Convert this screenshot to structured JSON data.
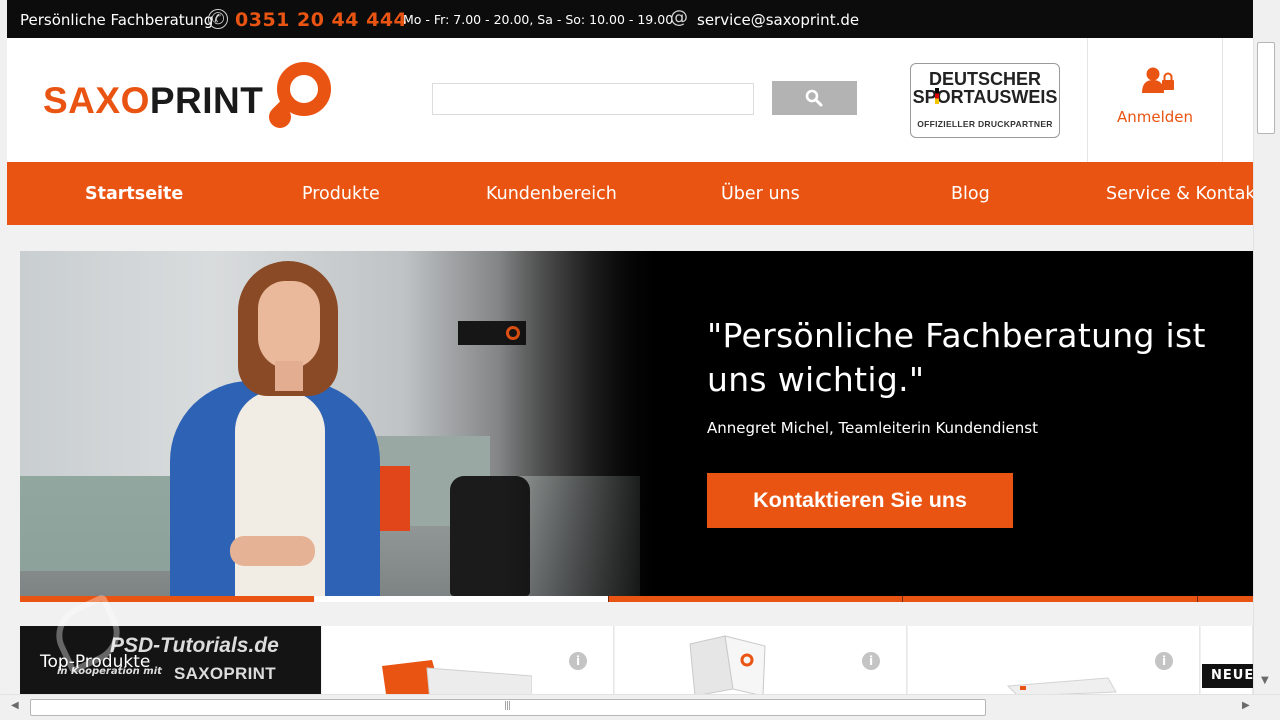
{
  "topbar": {
    "label": "Persönliche Fachberatung",
    "phone": "0351 20 44 444",
    "hours": "Mo - Fr: 7.00 - 20.00, Sa - So: 10.00 - 19.00",
    "email": "service@saxoprint.de"
  },
  "header": {
    "logo_text_orange": "SAXO",
    "logo_text_dark": "PRINT",
    "search": {
      "value": "",
      "placeholder": ""
    },
    "partner_badge": {
      "line1": "DEUTSCHER",
      "line2": "SPORTAUSWEIS",
      "line3": "OFFIZIELLER DRUCKPARTNER"
    },
    "login_label": "Anmelden"
  },
  "nav": {
    "items": [
      {
        "label": "Startseite",
        "active": true
      },
      {
        "label": "Produkte",
        "active": false
      },
      {
        "label": "Kundenbereich",
        "active": false
      },
      {
        "label": "Über uns",
        "active": false
      },
      {
        "label": "Blog",
        "active": false
      },
      {
        "label": "Service & Kontakt",
        "active": false
      }
    ]
  },
  "hero": {
    "quote": "\"Persönliche Fachberatung ist uns wichtig.\"",
    "author": "Annegret Michel, Teamleiterin Kundendienst",
    "cta_label": "Kontaktieren Sie uns",
    "slides_total": 5,
    "slide_current": 2
  },
  "products": {
    "section_label": "Top-Produkte",
    "info_icon_char": "i",
    "new_badge": "NEUE"
  },
  "watermark": {
    "line1": "PSD-Tutorials.de",
    "line2": "in Kooperation mit",
    "line3": "SAXOPRINT"
  },
  "colors": {
    "brand_orange": "#ea5412",
    "topbar_bg": "#0c0c0c",
    "search_button": "#b3b3b3"
  }
}
